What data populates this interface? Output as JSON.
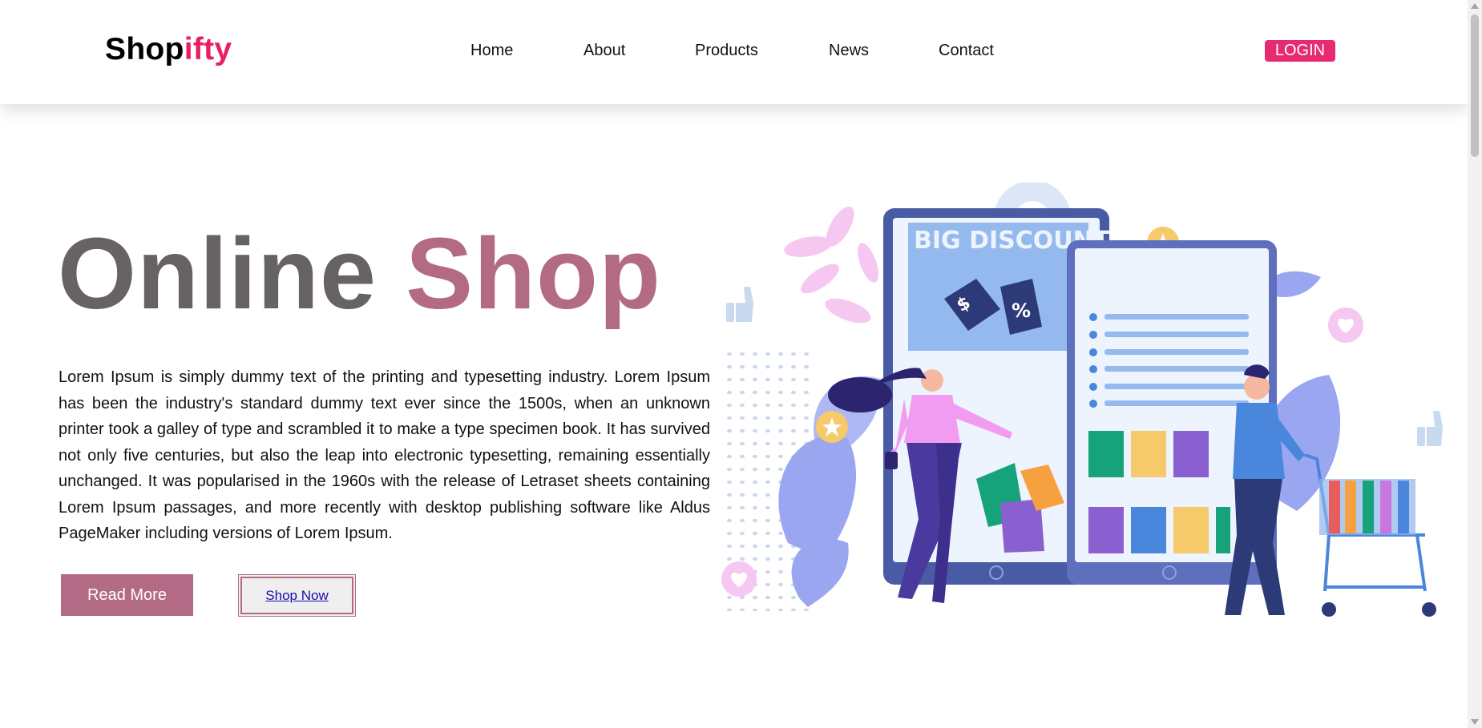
{
  "header": {
    "logo_main": "Shop",
    "logo_accent": "ifty",
    "nav": [
      {
        "label": "Home"
      },
      {
        "label": "About"
      },
      {
        "label": "Products"
      },
      {
        "label": "News"
      },
      {
        "label": "Contact"
      }
    ],
    "login_label": "LOGIN"
  },
  "hero": {
    "title_word1": "Online",
    "title_word2": "Shop",
    "paragraph": "Lorem Ipsum is simply dummy text of the printing and typesetting industry. Lorem Ipsum has been the industry's standard dummy text ever since the 1500s, when an unknown printer took a galley of type and scrambled it to make a type specimen book. It has survived not only five centuries, but also the leap into electronic typesetting, remaining essentially unchanged. It was popularised in the 1960s with the release of Letraset sheets containing Lorem Ipsum passages, and more recently with desktop publishing software like Aldus PageMaker including versions of Lorem Ipsum.",
    "read_more_label": "Read More",
    "shop_now_label": "Shop Now"
  },
  "illustration": {
    "banner_text": "BIG DISCOUNT",
    "tag1_text": "$",
    "tag2_text": "%"
  },
  "colors": {
    "brand_accent": "#e91e63",
    "login_bg": "#e62b72",
    "title_grey": "#676365",
    "title_pink": "#b36b85"
  }
}
